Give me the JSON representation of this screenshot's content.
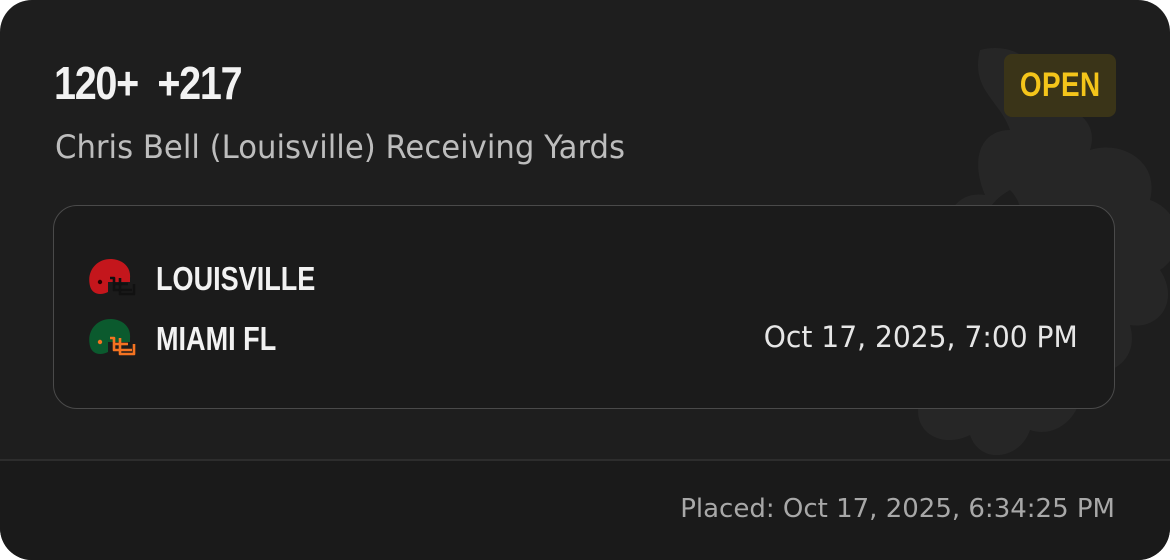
{
  "bet": {
    "selection": "120+",
    "odds": "+217",
    "market": "Chris Bell (Louisville) Receiving Yards",
    "status": "OPEN"
  },
  "game": {
    "teams": [
      {
        "name": "LOUISVILLE",
        "icon": "helmet-icon",
        "color": "#c4161c"
      },
      {
        "name": "MIAMI FL",
        "icon": "helmet-icon",
        "color": "#0b5a2e"
      }
    ],
    "start_time": "Oct 17, 2025, 7:00 PM"
  },
  "footer": {
    "placed": "Placed: Oct 17, 2025, 6:34:25 PM"
  },
  "colors": {
    "background": "#1e1e1e",
    "status_text": "#f4c51a",
    "status_bg": "#3a3418"
  }
}
